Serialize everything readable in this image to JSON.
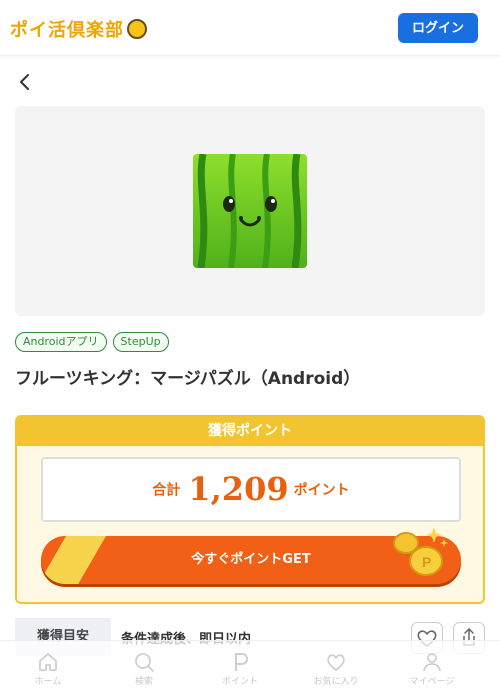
{
  "header": {
    "logo_text": "ポイ活倶楽部",
    "login_label": "ログイン"
  },
  "tags": [
    "Androidアプリ",
    "StepUp"
  ],
  "title": "フルーツキング：マージパズル（Android）",
  "points": {
    "header": "獲得ポイント",
    "total_label": "合計",
    "total_value": "1,209",
    "total_unit": "ポイント",
    "cta_label": "今すぐポイントGET"
  },
  "estimate": {
    "label": "獲得目安",
    "value": "条件達成後、即日以内"
  },
  "bottom_nav": [
    {
      "label": "ホーム",
      "icon": "home-icon"
    },
    {
      "label": "検索",
      "icon": "search-icon"
    },
    {
      "label": "ポイント",
      "icon": "point-icon"
    },
    {
      "label": "お気に入り",
      "icon": "heart-icon"
    },
    {
      "label": "マイページ",
      "icon": "user-icon"
    }
  ],
  "colors": {
    "accent": "#1a6fe0",
    "cta": "#f25f16",
    "points_border": "#f2c530",
    "tag": "#2e8c3a"
  }
}
